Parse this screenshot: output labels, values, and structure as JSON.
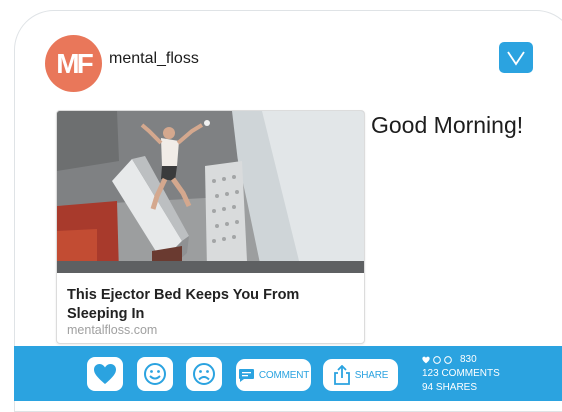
{
  "account": {
    "avatar_text": "MF",
    "username": "mental_floss",
    "avatar_color": "#e9775a"
  },
  "post": {
    "greeting": "Good Morning!",
    "link_preview": {
      "title": "This Ejector Bed Keeps You From Sleeping In",
      "source": "mentalfloss.com",
      "image": "man-jumping-off-ejector-bed"
    }
  },
  "actions": {
    "comment_label": "COMMENT",
    "share_label": "SHARE"
  },
  "stats": {
    "reactions_count": "830",
    "comments": "123 COMMENTS",
    "shares": "94 SHARES"
  },
  "colors": {
    "accent": "#2ba3e0",
    "background": "#ffffff"
  }
}
